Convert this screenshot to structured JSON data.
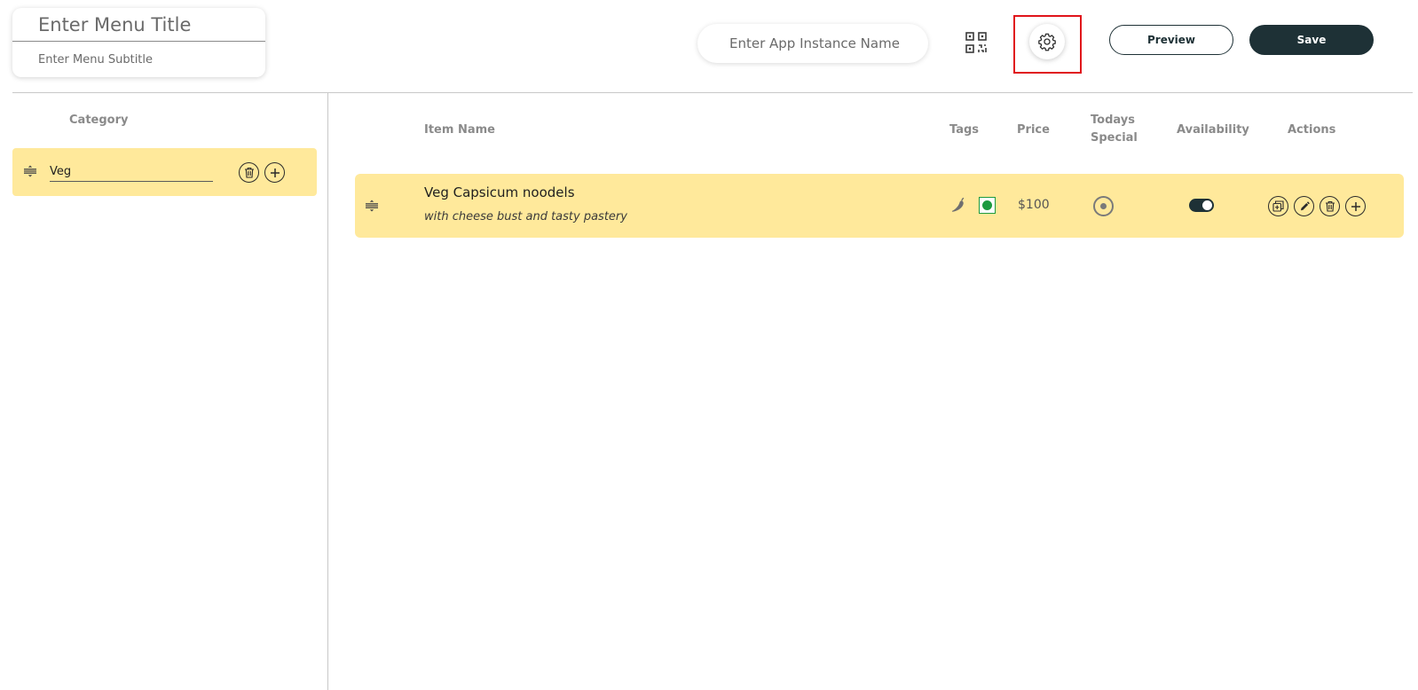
{
  "header": {
    "menu_title_placeholder": "Enter Menu Title",
    "menu_subtitle_placeholder": "Enter Menu Subtitle",
    "instance_name_placeholder": "Enter App Instance Name",
    "qr_icon": "qr-code-icon",
    "settings_icon": "gear-icon",
    "preview_label": "Preview",
    "save_label": "Save"
  },
  "categories": {
    "header": "Category",
    "items": [
      {
        "name": "Veg"
      }
    ]
  },
  "table": {
    "columns": {
      "item_name": "Item Name",
      "tags": "Tags",
      "price": "Price",
      "todays": "Todays",
      "special": "Special",
      "availability": "Availability",
      "actions": "Actions"
    },
    "items": [
      {
        "name": "Veg Capsicum noodels",
        "description": "with cheese bust and tasty pastery",
        "tags": [
          "chili-icon",
          "veg-icon"
        ],
        "price": "$100",
        "todays_special": false,
        "available": true
      }
    ]
  },
  "colors": {
    "accent": "#1e3136",
    "row_highlight": "#ffe99b",
    "veg_green": "#1c9a3f",
    "focus_outline": "#e0141b"
  }
}
